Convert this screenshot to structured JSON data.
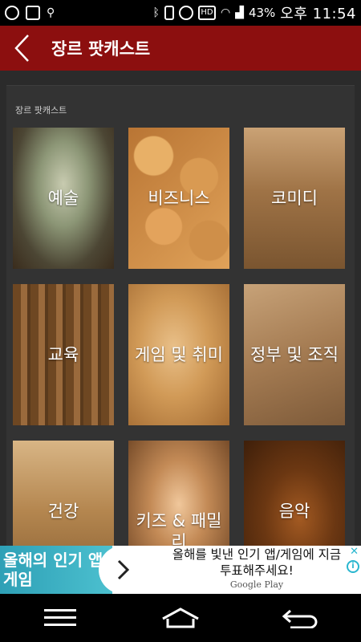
{
  "status_bar": {
    "battery_percent": "43%",
    "time": "오후 11:54",
    "left_icons": [
      "notification-g-icon",
      "plus-icon",
      "usb-icon"
    ],
    "right_icons": [
      "bluetooth-icon",
      "vibrate-icon",
      "alarm-icon",
      "hd-icon",
      "wifi-icon",
      "signal-icon",
      "battery-icon"
    ]
  },
  "header": {
    "title": "장르 팟캐스트",
    "back_icon": "chevron-left-icon",
    "background_color": "#8c0f0f"
  },
  "section": {
    "title": "장르 팟캐스트"
  },
  "genres": [
    {
      "label": "예술"
    },
    {
      "label": "비즈니스"
    },
    {
      "label": "코미디"
    },
    {
      "label": "교육"
    },
    {
      "label": "게임 및 취미"
    },
    {
      "label": "정부 및 조직"
    },
    {
      "label": "건강"
    },
    {
      "label": "키즈 & 패밀리"
    },
    {
      "label": "음악"
    }
  ],
  "ad": {
    "left_text": "올해의 인기 앱/게임",
    "main_text": "올해를 빛낸 인기 앱/게임에 지금 투표해주세요!",
    "sub_text": "Google Play",
    "accent_color": "#29b6cf"
  },
  "nav_bar": {
    "icons": [
      "menu-icon",
      "home-icon",
      "back-icon"
    ]
  }
}
